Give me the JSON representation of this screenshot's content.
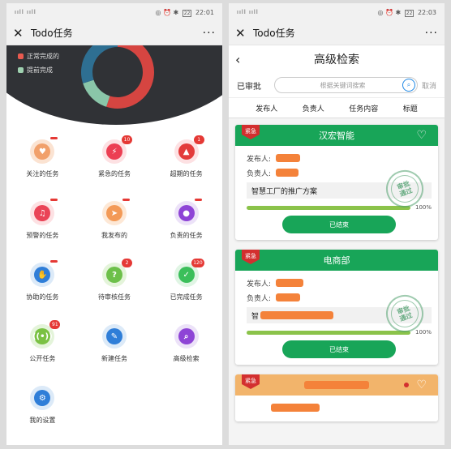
{
  "left": {
    "status": {
      "signal": "ııll ııll",
      "net": "",
      "icons": "◎ ⏰ ✱",
      "battery": "22",
      "time": "22:01"
    },
    "titlebar": {
      "title": "Todo任务",
      "more": "···"
    },
    "legend": [
      {
        "label": "正常完成的",
        "color": "#e85a4f"
      },
      {
        "label": "提前完成",
        "color": "#9fd1b0"
      }
    ],
    "donut_data": {
      "segments": [
        {
          "name": "正常完成的",
          "value": 55,
          "color": "#d64541"
        },
        {
          "name": "提前完成",
          "value": 15,
          "color": "#8ac6a9"
        },
        {
          "name": "",
          "value": 30,
          "color": "#2e6f92"
        }
      ]
    },
    "grid": [
      {
        "label": "关注的任务",
        "bg": "#fbe3d2",
        "fg": "#f1a06b",
        "glyph": "♥",
        "badge": "dash"
      },
      {
        "label": "紧急的任务",
        "bg": "#fde1e3",
        "fg": "#ec3f53",
        "glyph": "⚡",
        "badge": "10"
      },
      {
        "label": "超期的任务",
        "bg": "#fde1e3",
        "fg": "#e33b3b",
        "glyph": "▲",
        "badge": "1"
      },
      {
        "label": "预警的任务",
        "bg": "#fde1e3",
        "fg": "#ea4457",
        "glyph": "♫",
        "badge": "dash"
      },
      {
        "label": "我发布的",
        "bg": "#fde8d6",
        "fg": "#f39a57",
        "glyph": "➤",
        "badge": "dash"
      },
      {
        "label": "负责的任务",
        "bg": "#ece2f8",
        "fg": "#8e44d6",
        "glyph": "●",
        "badge": "dash"
      },
      {
        "label": "协助的任务",
        "bg": "#dceaf8",
        "fg": "#2f7ed8",
        "glyph": "✋",
        "badge": "dash"
      },
      {
        "label": "待审核任务",
        "bg": "#e4f4da",
        "fg": "#6dc04a",
        "glyph": "?",
        "badge": "2"
      },
      {
        "label": "已完成任务",
        "bg": "#e0f5e4",
        "fg": "#3bbf5a",
        "glyph": "✓",
        "badge": "120"
      },
      {
        "label": "公开任务",
        "bg": "#e4f4da",
        "fg": "#7ac143",
        "glyph": "((•))",
        "badge": "91"
      },
      {
        "label": "新建任务",
        "bg": "#dceaf8",
        "fg": "#2f7ed8",
        "glyph": "✎",
        "badge": ""
      },
      {
        "label": "高级检索",
        "bg": "#ece2f8",
        "fg": "#8e44d6",
        "glyph": "⌕",
        "badge": ""
      },
      {
        "label": "我的设置",
        "bg": "#dceaf8",
        "fg": "#2f7ed8",
        "glyph": "⚙",
        "badge": ""
      }
    ]
  },
  "right": {
    "status": {
      "signal": "ııll ııll",
      "icons": "◎ ⏰ ✱",
      "battery": "22",
      "time": "22:03"
    },
    "titlebar": {
      "title": "Todo任务",
      "more": "···"
    },
    "page_title": "高级检索",
    "search": {
      "label": "已审批",
      "placeholder": "根据关键词搜索",
      "cancel": "取消"
    },
    "columns": [
      "发布人",
      "负责人",
      "任务内容",
      "标题"
    ],
    "cards": [
      {
        "title": "汉宏智能",
        "urgent": "紧急",
        "publisher_label": "发布人:",
        "owner_label": "负责人:",
        "content": "智慧工厂的推广方案",
        "progress": 100,
        "progress_text": "100%",
        "button": "已结束",
        "stamp": "审批\n通过",
        "header_color": "green"
      },
      {
        "title": "电商部",
        "urgent": "紧急",
        "publisher_label": "发布人:",
        "owner_label": "负责人:",
        "content": "智",
        "progress": 100,
        "progress_text": "100%",
        "button": "已结束",
        "stamp": "审批\n通过",
        "header_color": "green"
      },
      {
        "title": "",
        "urgent": "紧急",
        "header_color": "orange"
      }
    ]
  }
}
